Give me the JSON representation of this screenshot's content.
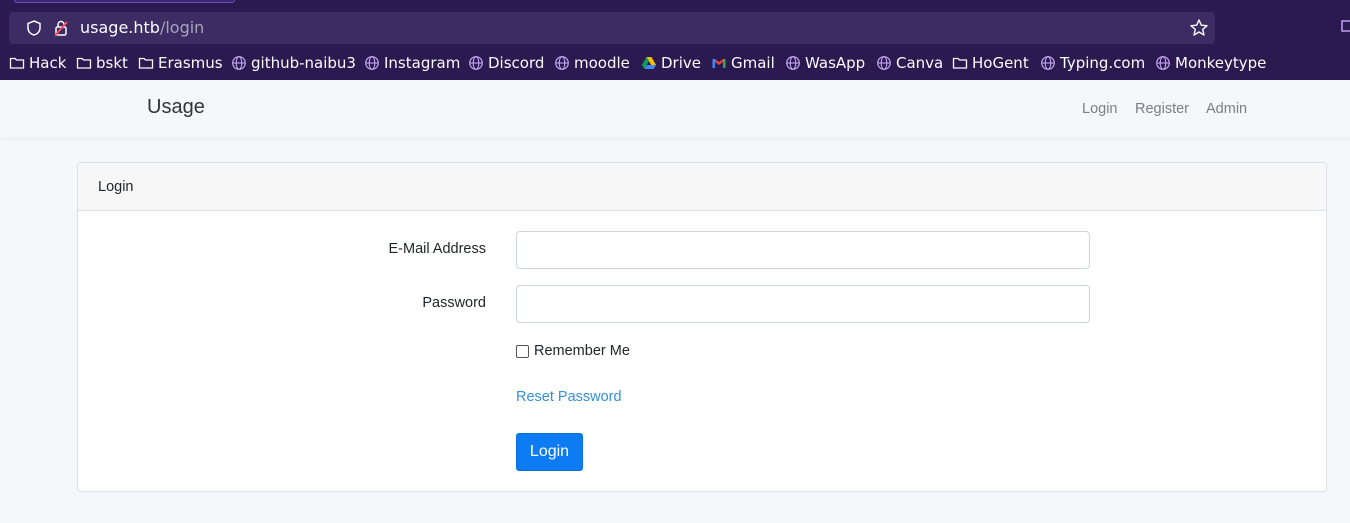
{
  "browser": {
    "url_host": "usage.htb",
    "url_path": "/login",
    "bookmarks": [
      {
        "label": "Hack",
        "icon": "folder-icon"
      },
      {
        "label": "bskt",
        "icon": "folder-icon"
      },
      {
        "label": "Erasmus",
        "icon": "folder-icon"
      },
      {
        "label": "github-naibu3",
        "icon": "globe-icon"
      },
      {
        "label": "Instagram",
        "icon": "globe-icon"
      },
      {
        "label": "Discord",
        "icon": "globe-icon"
      },
      {
        "label": "moodle",
        "icon": "globe-icon"
      },
      {
        "label": "Drive",
        "icon": "drive-icon"
      },
      {
        "label": "Gmail",
        "icon": "gmail-icon"
      },
      {
        "label": "WasApp",
        "icon": "globe-icon"
      },
      {
        "label": "Canva",
        "icon": "globe-icon"
      },
      {
        "label": "HoGent",
        "icon": "folder-icon"
      },
      {
        "label": "Typing.com",
        "icon": "globe-icon"
      },
      {
        "label": "Monkeytype",
        "icon": "globe-icon"
      }
    ]
  },
  "navbar": {
    "brand": "Usage",
    "links": [
      "Login",
      "Register",
      "Admin"
    ]
  },
  "card": {
    "header": "Login",
    "email_label": "E-Mail Address",
    "email_value": "",
    "password_label": "Password",
    "password_value": "",
    "remember_label": "Remember Me",
    "reset_label": "Reset Password",
    "submit_label": "Login"
  },
  "colors": {
    "browser_bg": "#2b1a4f",
    "primary": "#0d7cf2",
    "link": "#3490dc"
  }
}
